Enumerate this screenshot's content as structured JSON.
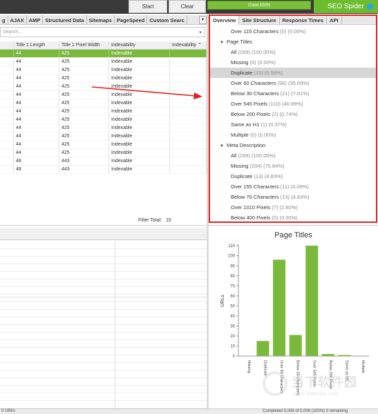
{
  "toolbar": {
    "start_label": "Start",
    "clear_label": "Clear",
    "progress_text": "Crawl 100%",
    "progress_fraction": 1.0,
    "brand": "SEO Spider"
  },
  "left_tabs": [
    "g",
    "AJAX",
    "AMP",
    "Structured Data",
    "Sitemaps",
    "PageSpeed",
    "Custom Searc"
  ],
  "search": {
    "placeholder": "Search..."
  },
  "table": {
    "headers": [
      "",
      "Title 1 Length",
      "Title 1 Pixel Width",
      "Indexability",
      "Indexability"
    ],
    "rows": [
      [
        "",
        "44",
        "425",
        "Indexable",
        ""
      ],
      [
        "",
        "44",
        "425",
        "Indexable",
        ""
      ],
      [
        "",
        "44",
        "425",
        "Indexable",
        ""
      ],
      [
        "",
        "44",
        "425",
        "Indexable",
        ""
      ],
      [
        "",
        "44",
        "425",
        "Indexable",
        ""
      ],
      [
        "",
        "44",
        "425",
        "Indexable",
        ""
      ],
      [
        "",
        "44",
        "425",
        "Indexable",
        ""
      ],
      [
        "",
        "44",
        "425",
        "Indexable",
        ""
      ],
      [
        "",
        "44",
        "425",
        "Indexable",
        ""
      ],
      [
        "",
        "44",
        "425",
        "Indexable",
        ""
      ],
      [
        "",
        "44",
        "425",
        "Indexable",
        ""
      ],
      [
        "",
        "44",
        "425",
        "Indexable",
        ""
      ],
      [
        "",
        "44",
        "425",
        "Indexable",
        ""
      ],
      [
        "",
        "48",
        "443",
        "Indexable",
        ""
      ],
      [
        "",
        "48",
        "443",
        "Indexable",
        ""
      ]
    ],
    "filter_total_label": "Filter Total:",
    "filter_total_value": "15"
  },
  "right_tabs": [
    "Overview",
    "Site Structure",
    "Response Times",
    "API"
  ],
  "overview": {
    "top_item": {
      "label": "Over 115 Characters",
      "count": "(0) (0.00%)"
    },
    "groups": [
      {
        "title": "Page Titles",
        "items": [
          {
            "label": "All",
            "count": "(269) (100.00%)"
          },
          {
            "label": "Missing",
            "count": "(0) (0.00%)"
          },
          {
            "label": "Duplicate",
            "count": "(15) (5.58%)",
            "selected": true
          },
          {
            "label": "Over 60 Characters",
            "count": "(96) (35.69%)"
          },
          {
            "label": "Below 30 Characters",
            "count": "(21) (7.81%)"
          },
          {
            "label": "Over 545 Pixels",
            "count": "(110) (40.89%)"
          },
          {
            "label": "Below 200 Pixels",
            "count": "(2) (0.74%)"
          },
          {
            "label": "Same as H1",
            "count": "(1) (0.37%)"
          },
          {
            "label": "Multiple",
            "count": "(0) (0.00%)"
          }
        ]
      },
      {
        "title": "Meta Description",
        "items": [
          {
            "label": "All",
            "count": "(269) (100.00%)"
          },
          {
            "label": "Missing",
            "count": "(204) (75.84%)"
          },
          {
            "label": "Duplicate",
            "count": "(13) (4.83%)"
          },
          {
            "label": "Over 155 Characters",
            "count": "(11) (4.09%)"
          },
          {
            "label": "Below 70 Characters",
            "count": "(13) (4.83%)"
          },
          {
            "label": "Over 1010 Pixels",
            "count": "(7) (2.60%)"
          },
          {
            "label": "Below 400 Pixels",
            "count": "(0) (0.00%)"
          }
        ]
      }
    ]
  },
  "chart_data": {
    "type": "bar",
    "title": "Page Titles",
    "ylabel": "URLs",
    "xlabel": "",
    "categories": [
      "Missing",
      "Duplicate",
      "Over 60 Characters",
      "Below 30 Characters",
      "Over 545 Pixels",
      "Below 200 Pixels",
      "Same as H1",
      "Multiple"
    ],
    "values": [
      0,
      15,
      96,
      21,
      110,
      2,
      1,
      0
    ],
    "ylim": [
      0,
      110
    ],
    "yticks": [
      0,
      10,
      20,
      30,
      40,
      50,
      60,
      70,
      80,
      90,
      100,
      110
    ],
    "grid": false,
    "color": "#7ab93b"
  },
  "status": {
    "left": "0 URI/s",
    "right": "Completed 5,006 of 5,006 (100%) 0 remaining"
  },
  "watermark": {
    "text": "当下软件园",
    "url": "www.downxia.com"
  },
  "colors": {
    "accent_green": "#7ab93b",
    "highlight_red": "#e02020"
  }
}
